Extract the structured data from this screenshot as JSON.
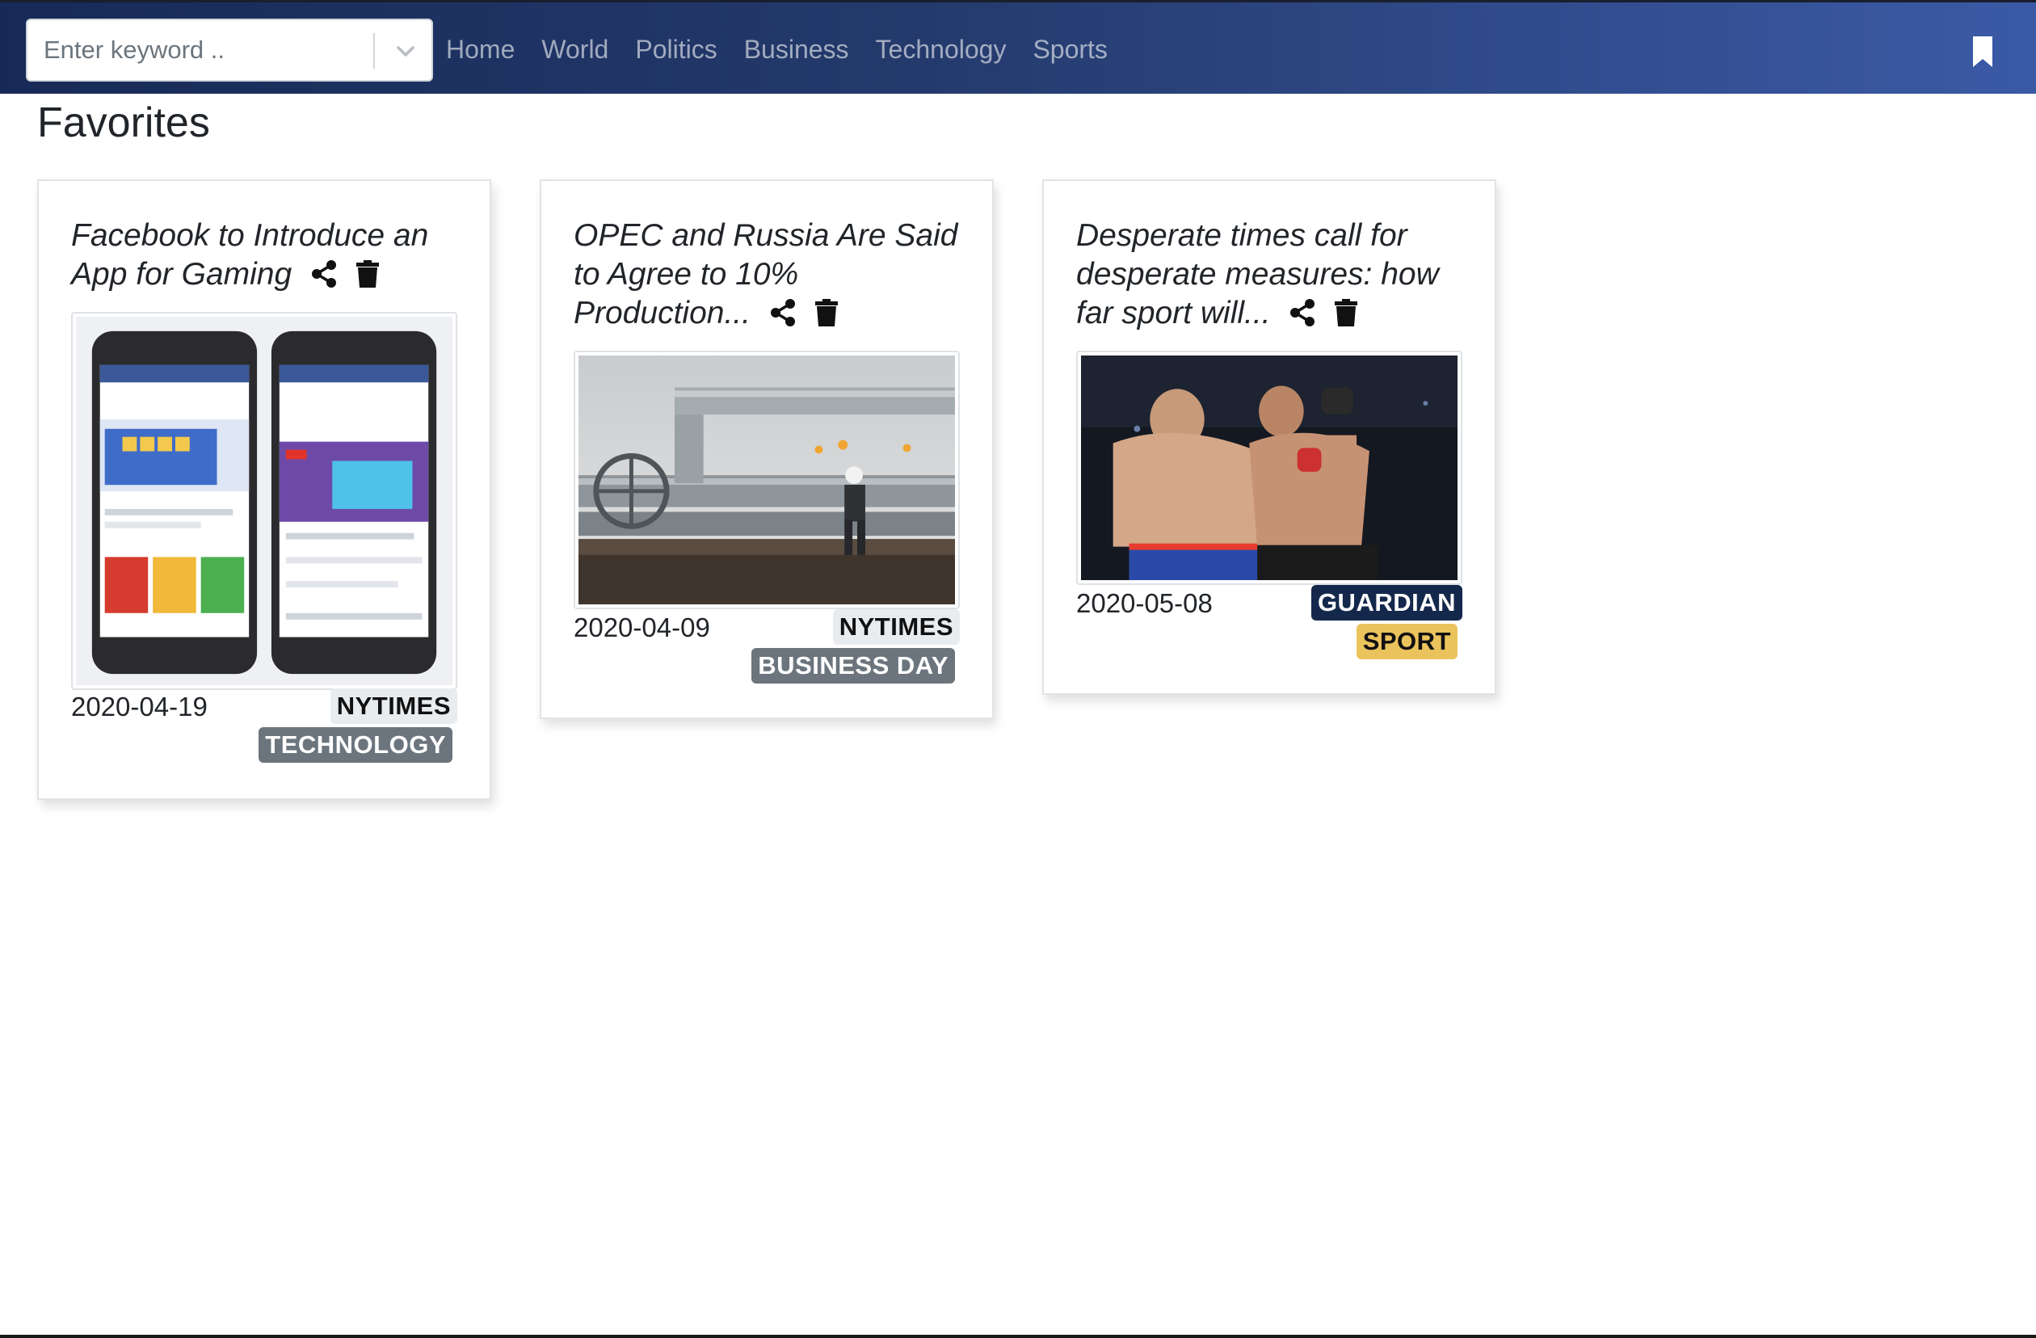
{
  "search": {
    "placeholder": "Enter keyword .."
  },
  "nav": {
    "links": [
      "Home",
      "World",
      "Politics",
      "Business",
      "Technology",
      "Sports"
    ]
  },
  "page": {
    "title": "Favorites"
  },
  "cards": [
    {
      "title": "Facebook to Introduce an App for Gaming",
      "date": "2020-04-19",
      "source": "NYTIMES",
      "section": "TECHNOLOGY",
      "image": "facebook-gaming-phones"
    },
    {
      "title": "OPEC and Russia Are Said to Agree to 10% Production...",
      "date": "2020-04-09",
      "source": "NYTIMES",
      "section": "BUSINESS DAY",
      "image": "oil-pipeline-worker"
    },
    {
      "title": "Desperate times call for desperate measures: how far sport will...",
      "date": "2020-05-08",
      "source": "GUARDIAN",
      "section": "SPORT",
      "image": "mma-fighters"
    }
  ],
  "icons": [
    "chevron-down-icon",
    "bookmark-icon",
    "share-icon",
    "trash-icon"
  ],
  "colors": {
    "navbar_start": "#172a57",
    "navbar_end": "#3b5aa6",
    "badge_gray": "#6c757d",
    "badge_navy": "#14284b",
    "badge_gold": "#ebc35d"
  }
}
